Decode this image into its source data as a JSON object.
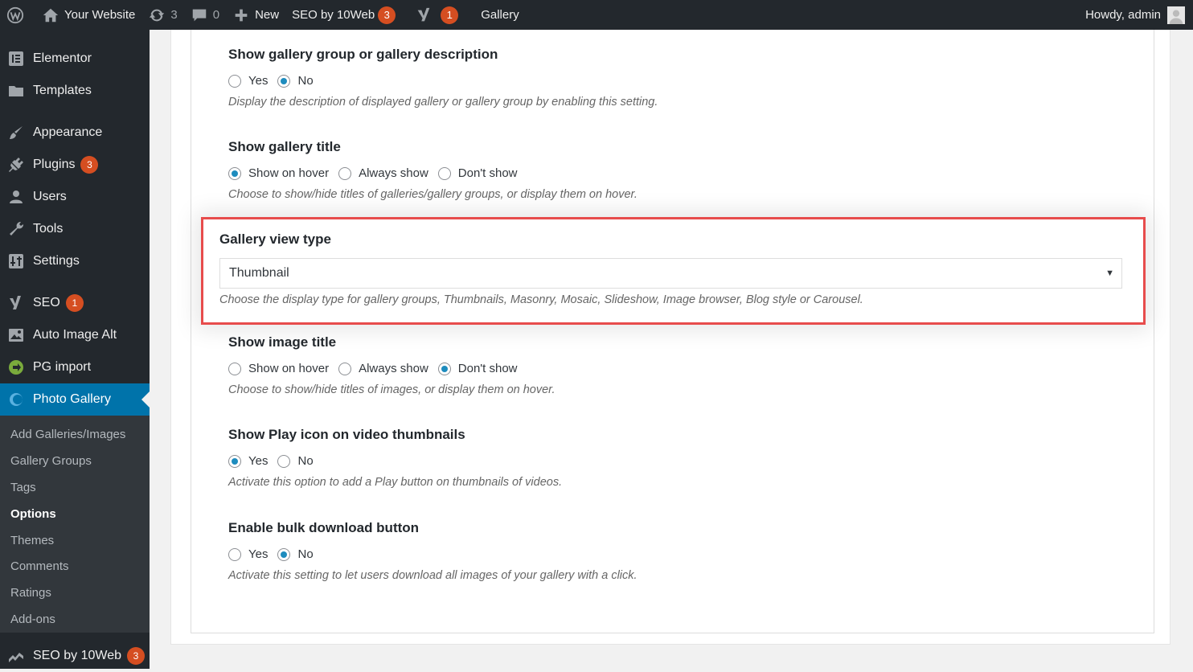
{
  "adminbar": {
    "site_name": "Your Website",
    "updates_count": "3",
    "comments_count": "0",
    "new_label": "New",
    "seo_label": "SEO by 10Web",
    "seo_badge": "3",
    "yoast_badge": "1",
    "gallery_label": "Gallery",
    "howdy": "Howdy, admin"
  },
  "sidebar": {
    "items": [
      {
        "label": "Elementor",
        "icon": "elementor-icon"
      },
      {
        "label": "Templates",
        "icon": "folder-icon"
      },
      {
        "label": "Appearance",
        "icon": "brush-icon"
      },
      {
        "label": "Plugins",
        "icon": "plug-icon",
        "badge": "3"
      },
      {
        "label": "Users",
        "icon": "user-icon"
      },
      {
        "label": "Tools",
        "icon": "wrench-icon"
      },
      {
        "label": "Settings",
        "icon": "settings-icon"
      },
      {
        "label": "SEO",
        "icon": "yoast-icon",
        "badge": "1"
      },
      {
        "label": "Auto Image Alt",
        "icon": "image-icon"
      },
      {
        "label": "PG import",
        "icon": "import-icon"
      },
      {
        "label": "Photo Gallery",
        "icon": "gallery-icon"
      }
    ],
    "submenu": [
      "Add Galleries/Images",
      "Gallery Groups",
      "Tags",
      "Options",
      "Themes",
      "Comments",
      "Ratings",
      "Add-ons"
    ],
    "bottom": {
      "label": "SEO by 10Web",
      "badge": "3"
    }
  },
  "options": {
    "group_desc": {
      "title": "Show gallery group or gallery description",
      "choices": [
        "Yes",
        "No"
      ],
      "selected": "No",
      "desc": "Display the description of displayed gallery or gallery group by enabling this setting."
    },
    "gallery_title": {
      "title": "Show gallery title",
      "choices": [
        "Show on hover",
        "Always show",
        "Don't show"
      ],
      "selected": "Show on hover",
      "desc": "Choose to show/hide titles of galleries/gallery groups, or display them on hover."
    },
    "view_type": {
      "title": "Gallery view type",
      "value": "Thumbnail",
      "desc": "Choose the display type for gallery groups, Thumbnails, Masonry, Mosaic, Slideshow, Image browser, Blog style or Carousel."
    },
    "image_title": {
      "title": "Show image title",
      "choices": [
        "Show on hover",
        "Always show",
        "Don't show"
      ],
      "selected": "Don't show",
      "desc": "Choose to show/hide titles of images, or display them on hover."
    },
    "play_icon": {
      "title": "Show Play icon on video thumbnails",
      "choices": [
        "Yes",
        "No"
      ],
      "selected": "Yes",
      "desc": "Activate this option to add a Play button on thumbnails of videos."
    },
    "bulk_download": {
      "title": "Enable bulk download button",
      "choices": [
        "Yes",
        "No"
      ],
      "selected": "No",
      "desc": "Activate this setting to let users download all images of your gallery with a click."
    }
  },
  "colors": {
    "adminbar_bg": "#23282d",
    "accent": "#0073aa",
    "badge": "#d54e21",
    "highlight_border": "#e74c4c"
  }
}
